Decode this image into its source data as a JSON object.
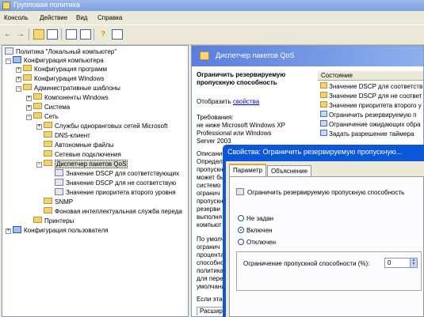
{
  "window": {
    "title": "Групповая политика"
  },
  "menu": [
    "Консоль",
    "Действие",
    "Вид",
    "Справка"
  ],
  "toolbar": {
    "icons": [
      "back-arrow-icon",
      "forward-arrow-icon",
      "up-folder-icon",
      "show-hide-tree-icon",
      "properties-icon",
      "export-list-icon",
      "help-icon",
      "console-icon"
    ]
  },
  "tree": {
    "root": "Политика \"Локальный компьютер\"",
    "computer_config": "Конфигурация компьютера",
    "program_config": "Конфигурация программ",
    "windows_config": "Конфигурация Windows",
    "admin_templates": "Административные шаблоны",
    "windows_components": "Компоненты Windows",
    "system": "Система",
    "network": "Сеть",
    "p2p": "Службы одноранговых сетей Microsoft",
    "dns": "DNS-клиент",
    "offline_files": "Автономные файлы",
    "net_connections": "Сетевые подключения",
    "qos": "Диспетчер пакетов QoS",
    "dscp1": "Значение DSCP для соответствующих",
    "dscp2": "Значение DSCP для не соответствую",
    "priority": "Значение приоритета второго уровня",
    "snmp": "SNMP",
    "bits": "Фоновая интеллектуальная служба переда",
    "printers": "Принтеры",
    "user_config": "Конфигурация пользователя"
  },
  "details": {
    "header": "Диспетчер пакетов QoS",
    "policy_title": "Ограничить резервируемую пропускную способность",
    "display_prefix": "Отобразить ",
    "display_link": "свойства",
    "requirements_label": "Требования:",
    "requirements_text": "не ниже Microsoft Windows XP Professional или Windows Server 2003",
    "description_label": "Описание:",
    "description_fragments": [
      "Определ",
      "пропускн",
      "может бы",
      "системо",
      "огранич",
      "пропускн",
      "резерви",
      "выполня",
      "компьют",
      "По умолча",
      "огранич",
      "процента",
      "способно",
      "политика",
      "для перец",
      "умолчани",
      "Если эта п"
    ],
    "bottom_tab": "Расшир",
    "column_header": "Состояние",
    "items": [
      "Значение DSCP для соответств",
      "Значение DSCP для не соответ",
      "Значение приоритета второго у",
      "Ограничить резервируемую п",
      "Ограничение ожидающих обра",
      "Задать разрешение таймера"
    ]
  },
  "dialog": {
    "title": "Свойства: Ограничить резервируемую пропускную...",
    "tabs": [
      "Параметр",
      "Объяснение"
    ],
    "setting_name": "Ограничить резервируемую пропускную способность",
    "options": [
      "Не задан",
      "Включен",
      "Отключен"
    ],
    "selected_option": "Включен",
    "limit_label": "Ограничение пропускной способности (%):",
    "limit_value": "0"
  }
}
